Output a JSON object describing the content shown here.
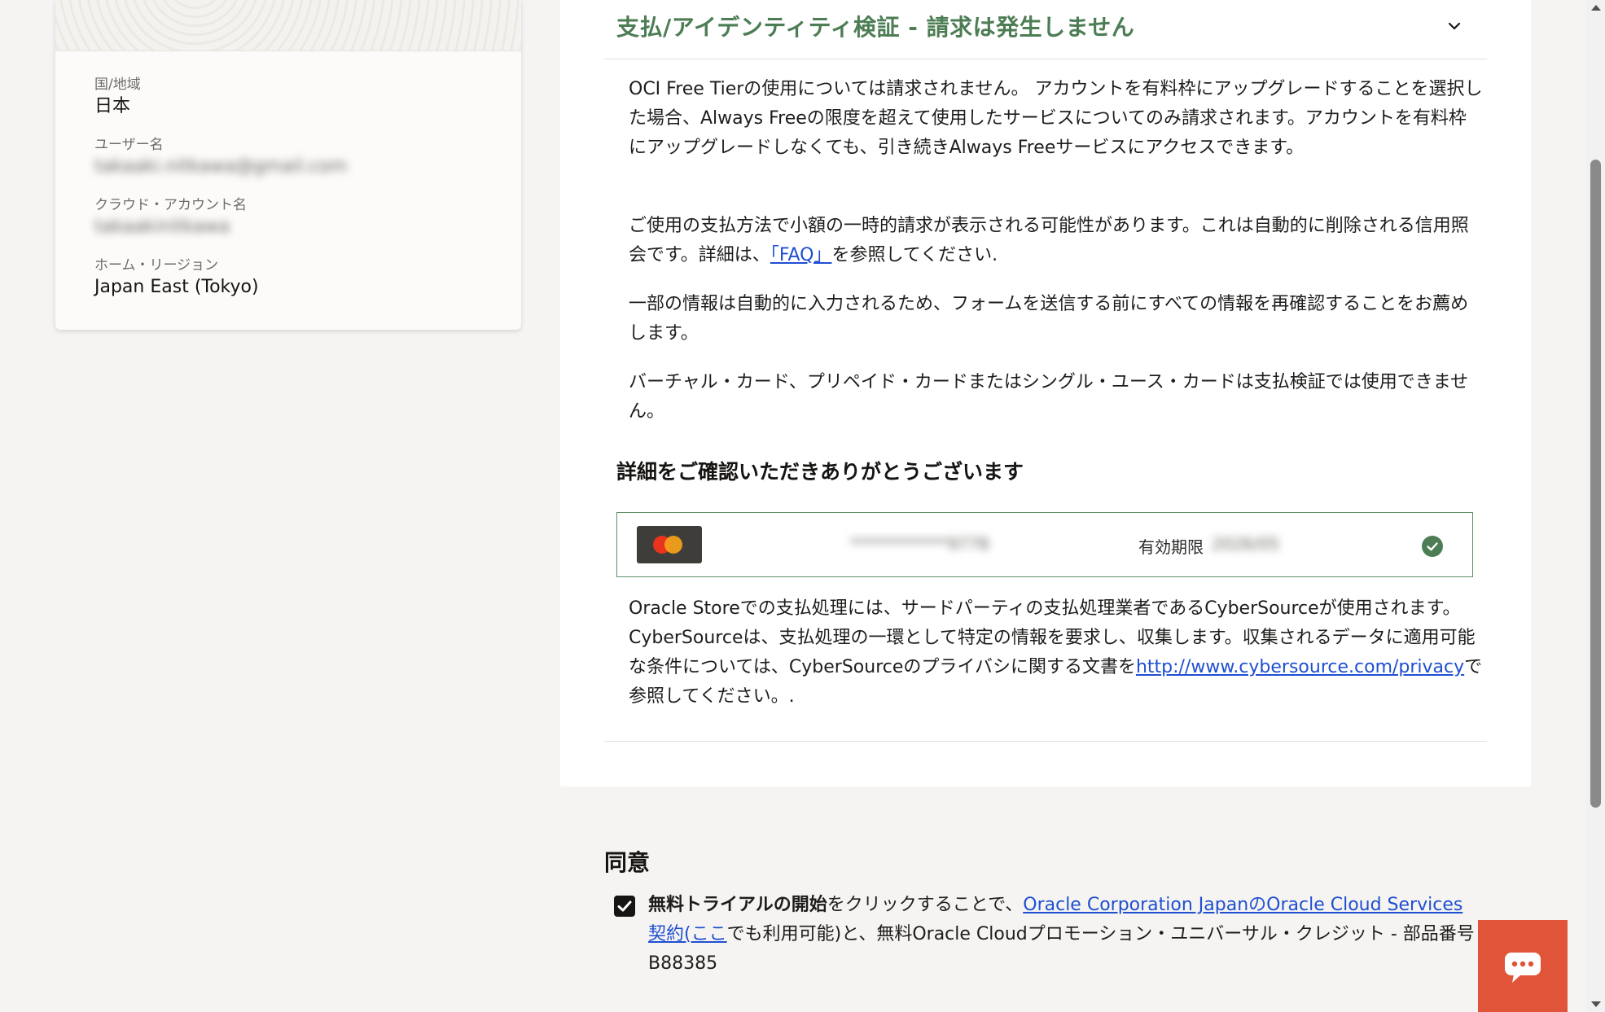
{
  "summary": {
    "country_label": "国/地域",
    "country_value": "日本",
    "username_label": "ユーザー名",
    "username_value": "takaaki.nitkawa@gmail.com",
    "cloud_account_label": "クラウド・アカウント名",
    "cloud_account_value": "takaakinitkawa",
    "home_region_label": "ホーム・リージョン",
    "home_region_value": "Japan East (Tokyo)"
  },
  "payment_section": {
    "title": "支払/アイデンティティ検証 - 請求は発生しません",
    "para1": "OCI Free Tierの使用については請求されません。 アカウントを有料枠にアップグレードすることを選択した場合、Always Freeの限度を超えて使用したサービスについてのみ請求されます。アカウントを有料枠にアップグレードしなくても、引き続きAlways Freeサービスにアクセスできます。",
    "para2_before": "ご使用の支払方法で小額の一時的請求が表示される可能性があります。これは自動的に削除される信用照会です。詳細は、",
    "para2_link": "「FAQ」",
    "para2_after": "を参照してください.",
    "para3": "一部の情報は自動的に入力されるため、フォームを送信する前にすべての情報を再確認することをお薦めします。",
    "para4": "バーチャル・カード、プリペイド・カードまたはシングル・ユース・カードは支払検証では使用できません。",
    "thanks_title": "詳細をご確認いただきありがとうございます",
    "card": {
      "number_masked": "************9778",
      "expiry_label": "有効期限",
      "expiry_value": "2026/05"
    },
    "para5_before": "Oracle Storeでの支払処理には、サードパーティの支払処理業者であるCyberSourceが使用されます。CyberSourceは、支払処理の一環として特定の情報を要求し、収集します。収集されるデータに適用可能な条件については、CyberSourceのプライバシに関する文書を",
    "para5_link": "http://www.cybersource.com/privacy",
    "para5_after": "で参照してください。."
  },
  "consent": {
    "title": "同意",
    "bold_text": "無料トライアルの開始",
    "text_before_link": "をクリックすることで、",
    "link1": "Oracle Corporation JapanのOracle Cloud Services契約",
    "paren_open": "(",
    "link2": "ここ",
    "text_after": "でも利用可能)と、無料Oracle Cloudプロモーション・ユニバーサル・クレジット - 部品番号B88385"
  },
  "colors": {
    "accent_green": "#4c7d54",
    "link_blue": "#1f4fd1",
    "chat_orange": "#e0543a"
  },
  "icons": {
    "chevron": "chevron-down-icon",
    "check": "check-circle-icon",
    "chat": "chat-icon",
    "checkbox": "checkbox-checked-icon"
  }
}
